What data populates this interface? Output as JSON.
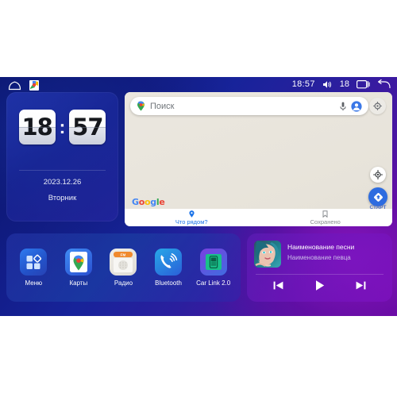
{
  "statusbar": {
    "home_icon": "home-icon",
    "maps_notification_icon": "google-maps-notification-icon",
    "time": "18:57",
    "volume_icon": "volume-icon",
    "volume_level": "18",
    "recents_icon": "recents-icon",
    "back_icon": "back-icon"
  },
  "clock": {
    "hours": "18",
    "separator": ":",
    "minutes": "57",
    "date": "2023.12.26",
    "weekday": "Вторник"
  },
  "maps": {
    "search_placeholder": "Поиск",
    "pin_icon": "google-maps-pin-icon",
    "mic_icon": "microphone-icon",
    "avatar_icon": "account-avatar-icon",
    "gear_icon": "gear-icon",
    "logo": "Google",
    "locate_icon": "my-location-icon",
    "start_icon": "directions-icon",
    "start_label": "СТАРТ",
    "tabs": [
      {
        "label": "Что рядом?",
        "icon": "place-pin-icon",
        "active": true
      },
      {
        "label": "Сохранено",
        "icon": "bookmark-icon",
        "active": false
      }
    ]
  },
  "dock": {
    "apps": [
      {
        "label": "Меню",
        "icon": "app-grid-icon"
      },
      {
        "label": "Карты",
        "icon": "google-maps-icon"
      },
      {
        "label": "Радио",
        "icon": "fm-radio-icon",
        "badge": "FM"
      },
      {
        "label": "Bluetooth",
        "icon": "bluetooth-phone-icon"
      },
      {
        "label": "Car Link 2.0",
        "icon": "car-link-icon"
      }
    ]
  },
  "music": {
    "album_art_icon": "album-art-portrait",
    "title": "Наименование песни",
    "artist": "Наименование певца",
    "controls": [
      {
        "name": "previous-button",
        "icon": "skip-previous-icon"
      },
      {
        "name": "play-button",
        "icon": "play-icon"
      },
      {
        "name": "next-button",
        "icon": "skip-next-icon"
      }
    ]
  },
  "colors": {
    "accent_blue": "#1a73e8",
    "map_bg": "#e9e5dd",
    "purple": "#7a16c3",
    "deep_blue": "#0a1470"
  }
}
